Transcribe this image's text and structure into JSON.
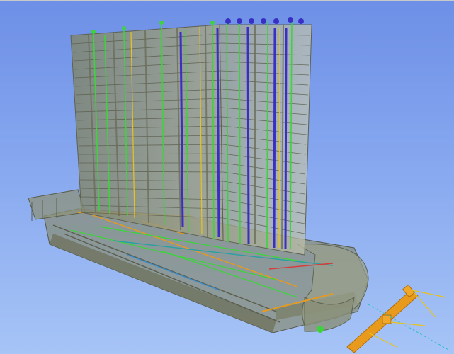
{
  "viewport": {
    "view": "3D BIM model",
    "colors": {
      "sky_top": "#6d8fe6",
      "sky_bottom": "#a6c4f6",
      "structure": "#8f9478",
      "structure_edge": "#5a5d4c",
      "pipe_green": "#3fd23f",
      "pipe_blue": "#3a2fc4",
      "duct_orange": "#e89a1c",
      "accent_red": "#d93a3a"
    }
  }
}
